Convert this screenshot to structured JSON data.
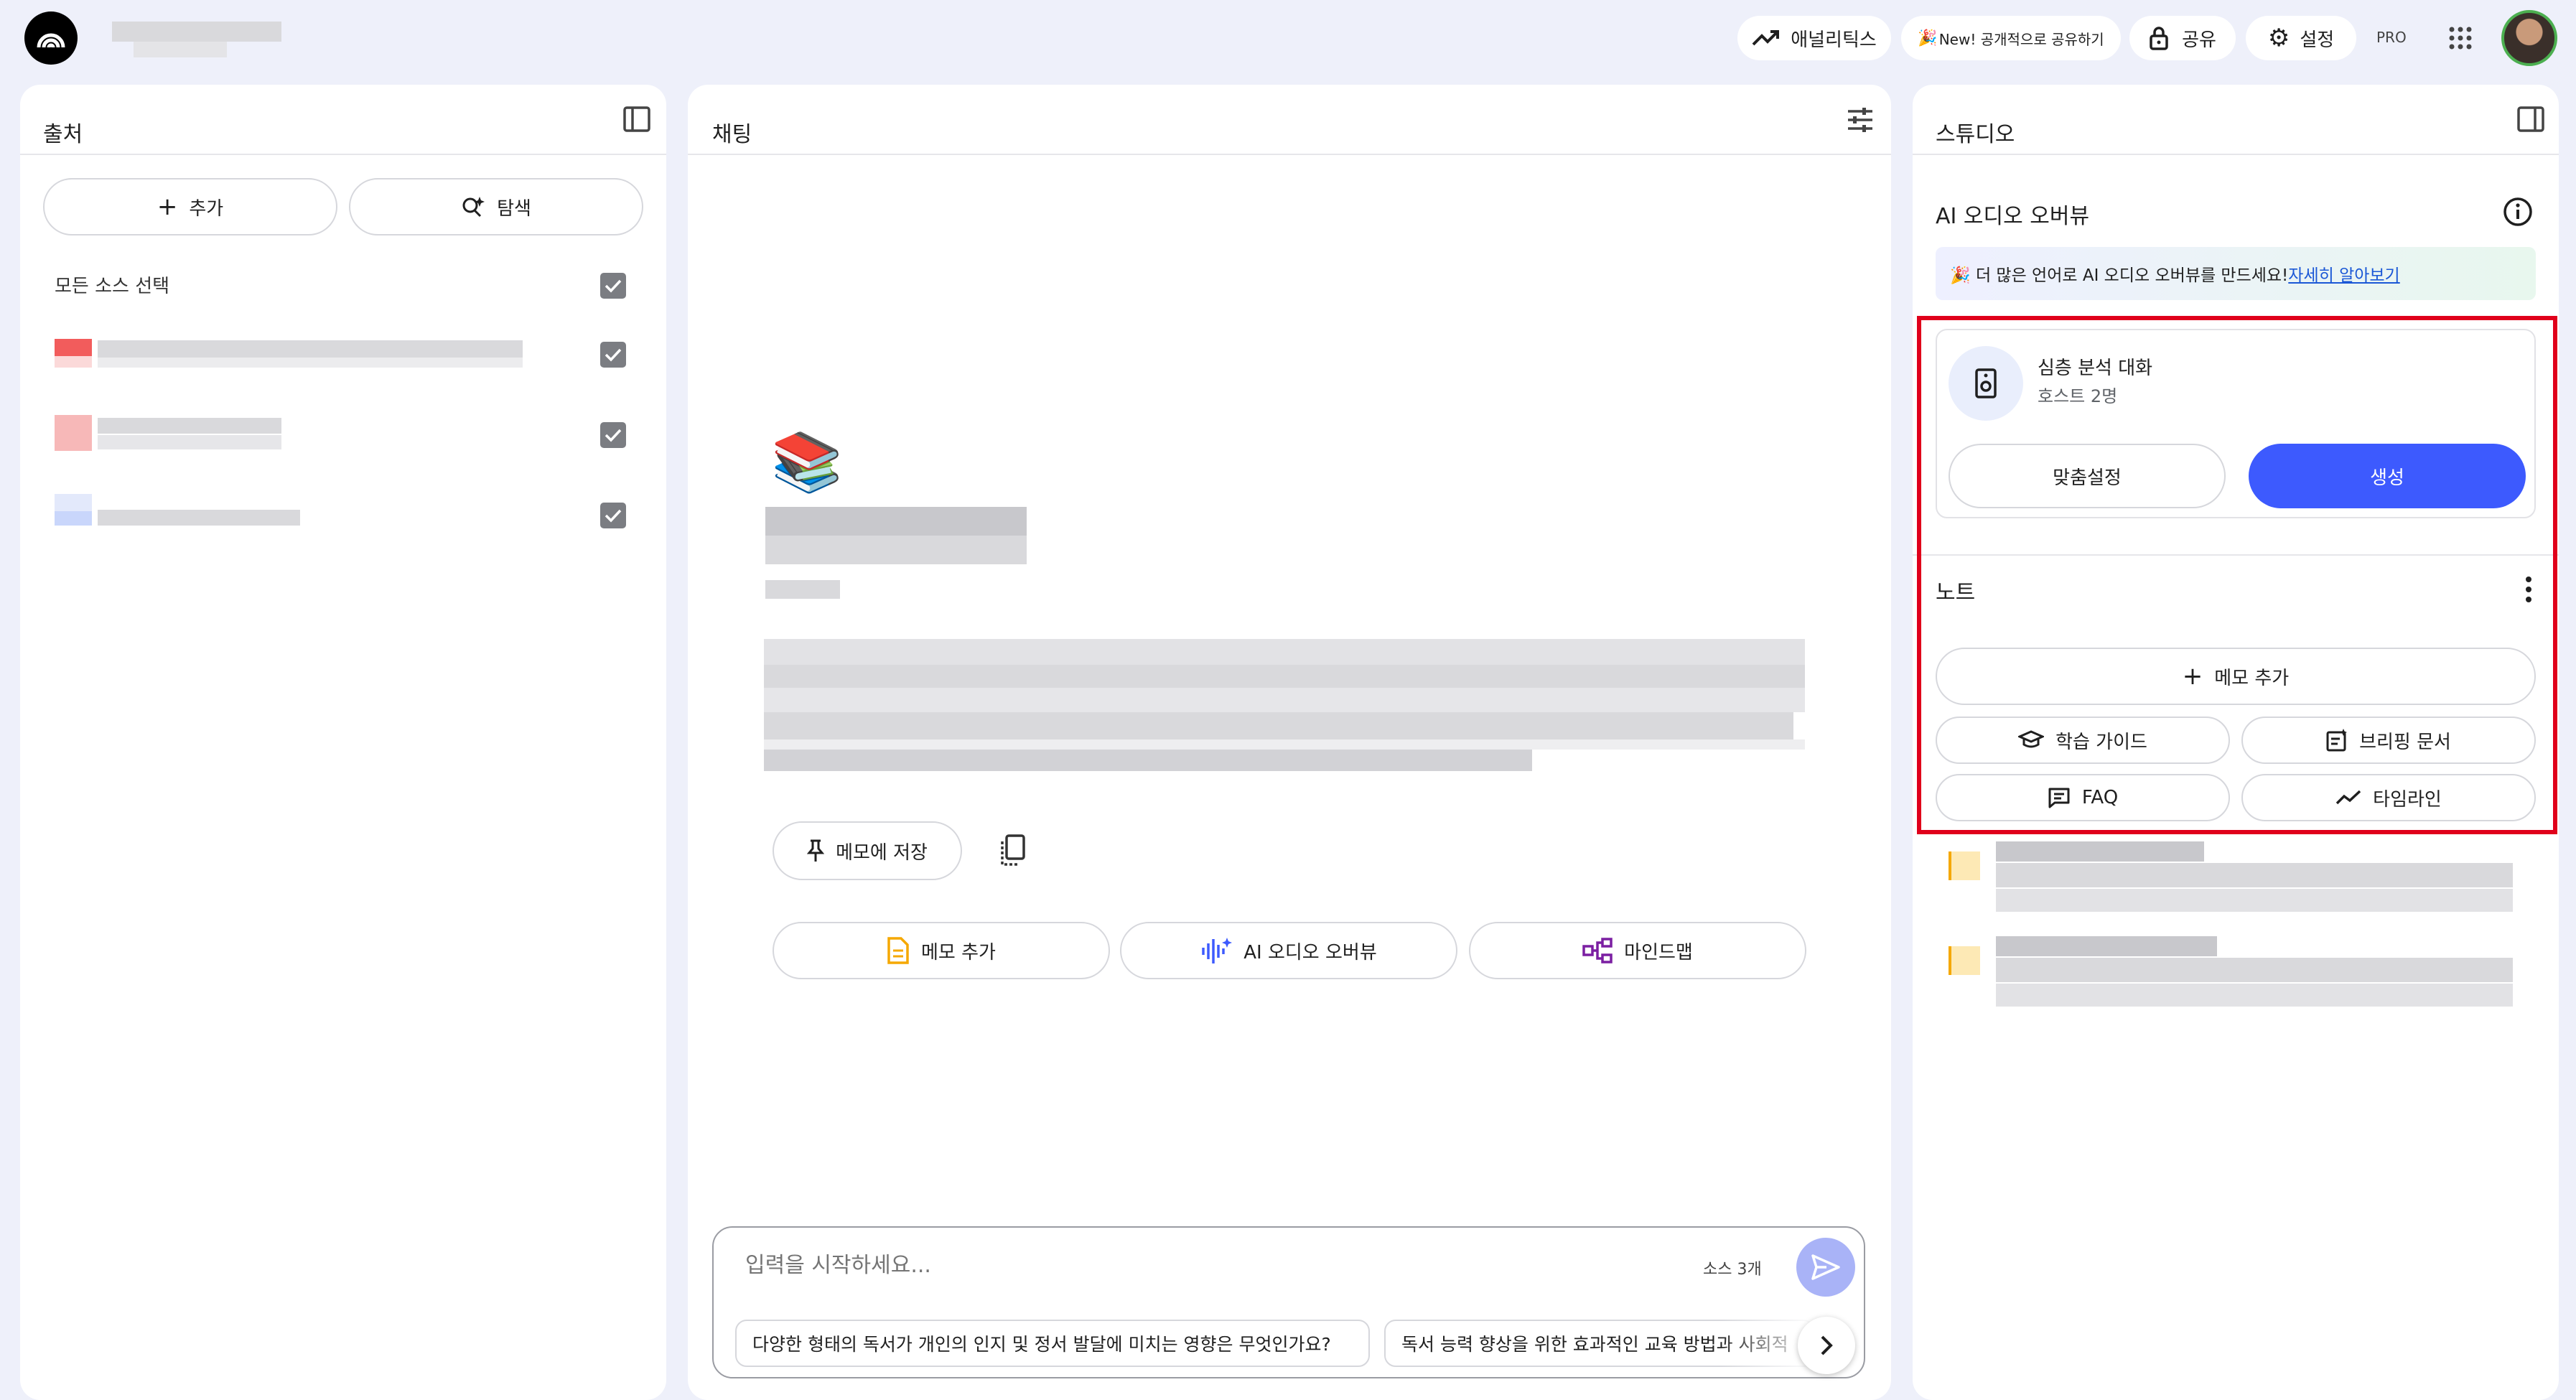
{
  "topbar": {
    "analytics_label": "애널리틱스",
    "share_public_label": "New! 공개적으로 공유하기",
    "share_label": "공유",
    "settings_label": "설정",
    "pro_badge": "PRO"
  },
  "sources": {
    "title": "출처",
    "add_label": "추가",
    "discover_label": "탐색",
    "select_all_label": "모든 소스 선택"
  },
  "chat": {
    "title": "채팅",
    "emoji": "📚",
    "save_note_label": "메모에 저장",
    "actions": [
      {
        "label": "메모 추가"
      },
      {
        "label": "AI 오디오 오버뷰"
      },
      {
        "label": "마인드맵"
      }
    ],
    "input_placeholder": "입력을 시작하세요...",
    "source_count": "소스 3개",
    "suggestions": [
      "다양한 형태의 독서가 개인의 인지 및 정서 발달에 미치는 영향은 무엇인가요?",
      "독서 능력 향상을 위한 효과적인 교육 방법과 사회적"
    ]
  },
  "studio": {
    "title": "스튜디오",
    "audio_overview_title": "AI 오디오 오버뷰",
    "banner_text": "🎉 더 많은 언어로 AI 오디오 오버뷰를 만드세요!",
    "banner_link": "자세히 알아보기",
    "deep_dive_title": "심층 분석 대화",
    "deep_dive_subtitle": "호스트 2명",
    "customize_label": "맞춤설정",
    "generate_label": "생성",
    "notes_title": "노트",
    "add_memo_label": "메모 추가",
    "study_guide_label": "학습 가이드",
    "briefing_label": "브리핑 문서",
    "faq_label": "FAQ",
    "timeline_label": "타임라인"
  },
  "colors": {
    "accent_blue": "#3d5afe",
    "highlight_red": "#e0001b",
    "send_button": "#a9b3f7",
    "background": "#eef0fa"
  }
}
